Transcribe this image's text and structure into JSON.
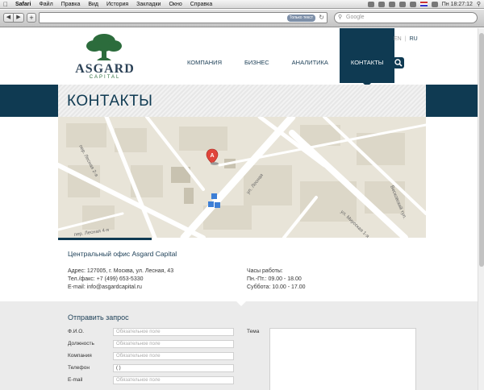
{
  "os_menu": {
    "app": "Safari",
    "items": [
      "Файл",
      "Правка",
      "Вид",
      "История",
      "Закладки",
      "Окно",
      "Справка"
    ],
    "clock": "Пн 18:27:12"
  },
  "browser": {
    "reader_badge": "Только текст",
    "search_placeholder": "Google"
  },
  "site": {
    "logo_text": "ASGARD",
    "logo_sub": "CAPITAL",
    "nav": [
      "КОМПАНИЯ",
      "БИЗНЕС",
      "АНАЛИТИКА",
      "КОНТАКТЫ"
    ],
    "active_nav": "КОНТАКТЫ",
    "lang": [
      "EN",
      "RU"
    ],
    "active_lang": "RU",
    "page_title": "КОНТАКТЫ"
  },
  "map": {
    "streets": [
      "ул. Лесная",
      "ул. Миусская 1-я",
      "пер. Лесная 2-я",
      "пер. Лесная 4-я",
      "Весковский туп."
    ],
    "marker": "A"
  },
  "contacts": {
    "office_title": "Центральный офис Asgard Capital",
    "address": "Адрес:  127005, г. Москва, ул. Лесная, 43",
    "phone": "Тел./факс:  +7 (499) 653-5330",
    "email": "E-mail:  info@asgardcapital.ru",
    "hours_title": "Часы работы:",
    "hours_weekdays": "Пн.-Пт.:  09.00 - 18.00",
    "hours_saturday": "Суббота: 10.00 - 17.00"
  },
  "form": {
    "title": "Отправить запрос",
    "fields": [
      {
        "label": "Ф.И.О.",
        "placeholder": "Обязательное поле",
        "value": ""
      },
      {
        "label": "Должность",
        "placeholder": "Обязательное поле",
        "value": ""
      },
      {
        "label": "Компания",
        "placeholder": "Обязательное поле",
        "value": ""
      },
      {
        "label": "Телефон",
        "placeholder": "",
        "value": "(     )"
      },
      {
        "label": "E-mail",
        "placeholder": "Обязательное поле",
        "value": ""
      }
    ],
    "topic_label": "Тема"
  },
  "colors": {
    "brand_navy": "#0f3a52",
    "brand_green": "#2c6c3c",
    "map_bg": "#e8e4d8"
  }
}
